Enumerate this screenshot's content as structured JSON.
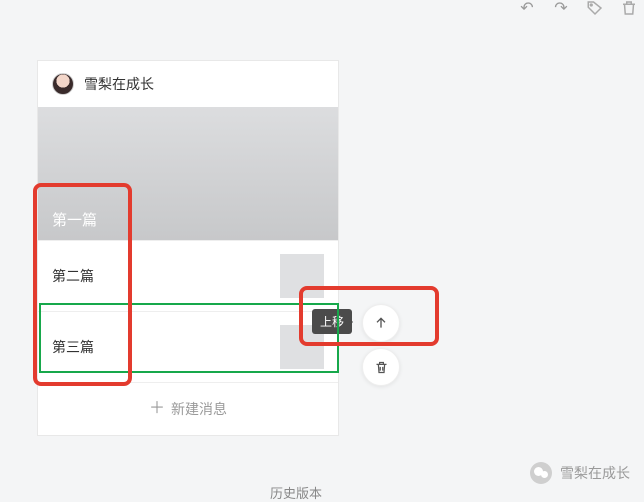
{
  "toolbar": {
    "undo": "↶",
    "redo": "↷"
  },
  "author": {
    "name": "雪梨在成长"
  },
  "cover": {
    "title": "第一篇"
  },
  "rows": [
    {
      "title": "第二篇"
    },
    {
      "title": "第三篇"
    }
  ],
  "new_message": "新建消息",
  "tooltip": {
    "move_up": "上移"
  },
  "footer": {
    "history": "历史版本"
  },
  "wechat": {
    "name": "雪梨在成长"
  }
}
